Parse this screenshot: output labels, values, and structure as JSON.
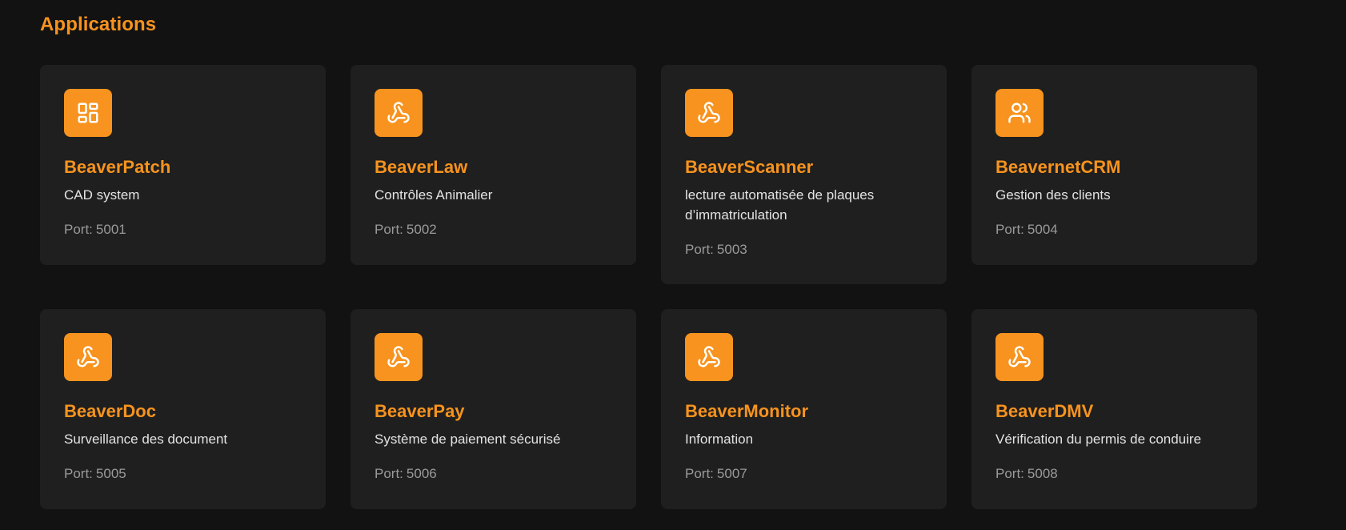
{
  "section": {
    "title": "Applications"
  },
  "port_label": "Port:",
  "colors": {
    "accent": "#f7931e",
    "card_bg": "#1f1f1f",
    "page_bg": "#121212"
  },
  "apps": [
    {
      "name": "BeaverPatch",
      "description": "CAD system",
      "port": "5001",
      "icon": "dashboard-icon"
    },
    {
      "name": "BeaverLaw",
      "description": "Contrôles Animalier",
      "port": "5002",
      "icon": "webhook-icon"
    },
    {
      "name": "BeaverScanner",
      "description": "lecture automatisée de plaques d’immatriculation",
      "port": "5003",
      "icon": "webhook-icon"
    },
    {
      "name": "BeavernetCRM",
      "description": "Gestion des clients",
      "port": "5004",
      "icon": "users-icon"
    },
    {
      "name": "BeaverDoc",
      "description": "Surveillance des document",
      "port": "5005",
      "icon": "webhook-icon"
    },
    {
      "name": "BeaverPay",
      "description": "Système de paiement sécurisé",
      "port": "5006",
      "icon": "webhook-icon"
    },
    {
      "name": "BeaverMonitor",
      "description": "Information",
      "port": "5007",
      "icon": "webhook-icon"
    },
    {
      "name": "BeaverDMV",
      "description": "Vérification du permis de conduire",
      "port": "5008",
      "icon": "webhook-icon"
    }
  ]
}
